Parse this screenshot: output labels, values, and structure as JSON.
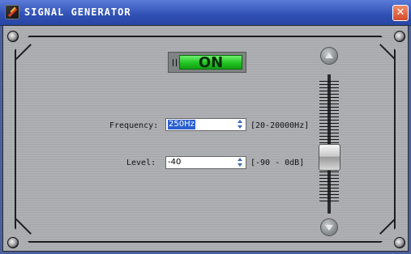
{
  "window": {
    "title": "SIGNAL GENERATOR",
    "close_glyph": "✕",
    "icon": "signal-generator-icon"
  },
  "power_toggle": {
    "label": "ON",
    "state": "on",
    "color": "#21c421"
  },
  "frequency": {
    "label": "Frequency:",
    "value": "250Hz",
    "range": "[20-20000Hz]"
  },
  "level": {
    "label": "Level:",
    "value": "-40",
    "range": "[-90 - 0dB]"
  },
  "level_fader": {
    "min_db": -90,
    "max_db": 0,
    "value_db": -40
  }
}
